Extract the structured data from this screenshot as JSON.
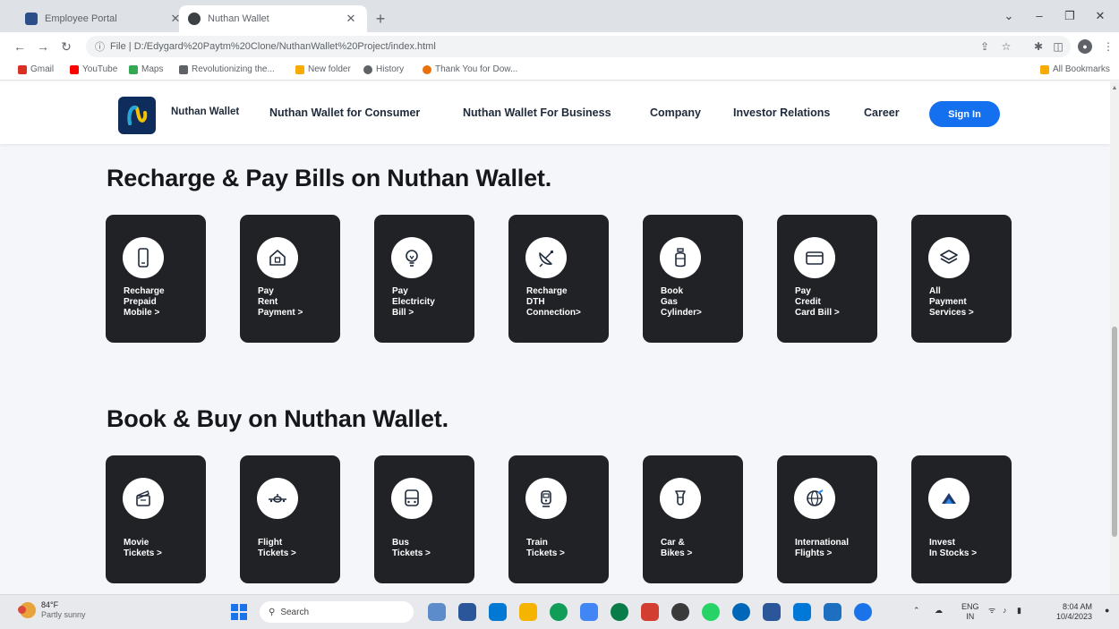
{
  "browser": {
    "tabs": [
      {
        "title": "Employee Portal",
        "favicon_color": "#2c4f8a"
      },
      {
        "title": "Nuthan Wallet",
        "favicon_color": "#3c4043"
      }
    ],
    "url": "File | D:/Edygard%20Paytm%20Clone/NuthanWallet%20Project/index.html",
    "bookmarks": [
      {
        "label": "Gmail",
        "color": "#d93025"
      },
      {
        "label": "YouTube",
        "color": "#ff0000"
      },
      {
        "label": "Maps",
        "color": "#34a853"
      },
      {
        "label": "Revolutionizing the...",
        "color": "#5f6368"
      },
      {
        "label": "New folder",
        "color": "#f9ab00"
      },
      {
        "label": "History",
        "color": "#5f6368"
      },
      {
        "label": "Thank You for Dow...",
        "color": "#e8710a"
      }
    ],
    "all_bookmarks": "All Bookmarks"
  },
  "nav": {
    "brand": "Nuthan Wallet",
    "links": [
      "Nuthan Wallet for Consumer",
      "Nuthan Wallet For Business",
      "Company",
      "Investor Relations",
      "Career"
    ],
    "signin": "Sign In"
  },
  "sections": [
    {
      "title": "Recharge & Pay Bills on Nuthan Wallet.",
      "cards": [
        {
          "label": "Recharge\nPrepaid\nMobile >",
          "icon": "mobile-phone-icon"
        },
        {
          "label": "Pay\nRent\nPayment >",
          "icon": "house-icon"
        },
        {
          "label": "Pay\nElectricity\nBill >",
          "icon": "lightbulb-icon"
        },
        {
          "label": "Recharge\nDTH\nConnection>",
          "icon": "satellite-dish-icon"
        },
        {
          "label": "Book\nGas\nCylinder>",
          "icon": "gas-cylinder-icon"
        },
        {
          "label": "Pay\nCredit\nCard Bill >",
          "icon": "credit-card-icon"
        },
        {
          "label": "All\nPayment\nServices >",
          "icon": "layers-icon"
        }
      ]
    },
    {
      "title": "Book & Buy on Nuthan Wallet.",
      "cards": [
        {
          "label": "Movie\nTickets >",
          "icon": "clapperboard-icon"
        },
        {
          "label": "Flight\nTickets >",
          "icon": "airplane-icon"
        },
        {
          "label": "Bus\nTickets >",
          "icon": "bus-icon"
        },
        {
          "label": "Train\nTickets >",
          "icon": "train-icon"
        },
        {
          "label": "Car &\nBikes >",
          "icon": "car-icon"
        },
        {
          "label": "International\nFlights >",
          "icon": "globe-icon"
        },
        {
          "label": "Invest\nIn Stocks >",
          "icon": "stock-chart-icon"
        }
      ]
    }
  ],
  "taskbar": {
    "weather_temp": "84°F",
    "weather_desc": "Partly sunny",
    "search_placeholder": "Search",
    "lang": "ENG",
    "region": "IN",
    "time": "8:04 AM",
    "date": "10/4/2023",
    "apps": [
      "#5c8cc9",
      "#2b579a",
      "#0078d4",
      "#f4b400",
      "#0f9d58",
      "#4285f4",
      "#0a7c4a",
      "#d23f31",
      "#3a3a3a",
      "#25d366",
      "#0067b8",
      "#2b579a",
      "#0078d7",
      "#1e6fbf",
      "#1a73e8"
    ]
  }
}
